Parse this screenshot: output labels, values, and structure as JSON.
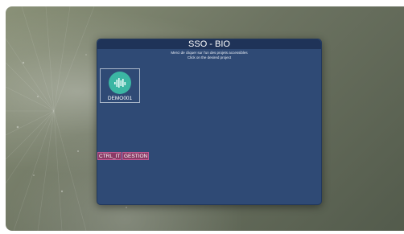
{
  "dialog": {
    "title": "SSO - BIO",
    "subtitle_fr": "Merci de cliquer sur l'un des projets accessibles",
    "subtitle_en": "Click on the desired project"
  },
  "projects": [
    {
      "label": "DEMO001",
      "icon": "equalizer-icon"
    }
  ],
  "tags": [
    {
      "label": "CTRL_IT"
    },
    {
      "label": "GESTION"
    }
  ],
  "colors": {
    "dialog_bg": "#2f4a75",
    "project_icon": "#3bb6a3",
    "tag_bg": "#8a3b66"
  }
}
